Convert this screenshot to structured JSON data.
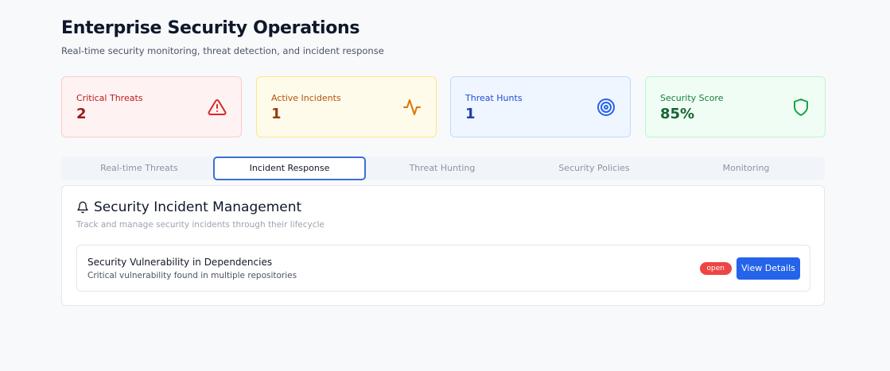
{
  "header": {
    "title": "Enterprise Security Operations",
    "subtitle": "Real-time security monitoring, threat detection, and incident response"
  },
  "stats": [
    {
      "label": "Critical Threats",
      "value": "2",
      "icon": "alert-triangle-icon",
      "color": "#dc2626"
    },
    {
      "label": "Active Incidents",
      "value": "1",
      "icon": "activity-icon",
      "color": "#d97706"
    },
    {
      "label": "Threat Hunts",
      "value": "1",
      "icon": "target-icon",
      "color": "#2563eb"
    },
    {
      "label": "Security Score",
      "value": "85%",
      "icon": "shield-icon",
      "color": "#16a34a"
    }
  ],
  "tabs": [
    {
      "label": "Real-time Threats",
      "active": false
    },
    {
      "label": "Incident Response",
      "active": true
    },
    {
      "label": "Threat Hunting",
      "active": false
    },
    {
      "label": "Security Policies",
      "active": false
    },
    {
      "label": "Monitoring",
      "active": false
    }
  ],
  "panel": {
    "icon": "bell-icon",
    "title": "Security Incident Management",
    "description": "Track and manage security incidents through their lifecycle",
    "incidents": [
      {
        "title": "Security Vulnerability in Dependencies",
        "description": "Critical vulnerability found in multiple repositories",
        "status": "open",
        "action_label": "View Details"
      }
    ]
  },
  "colors": {
    "accent": "#2563eb",
    "status_open": "#ef4444"
  }
}
